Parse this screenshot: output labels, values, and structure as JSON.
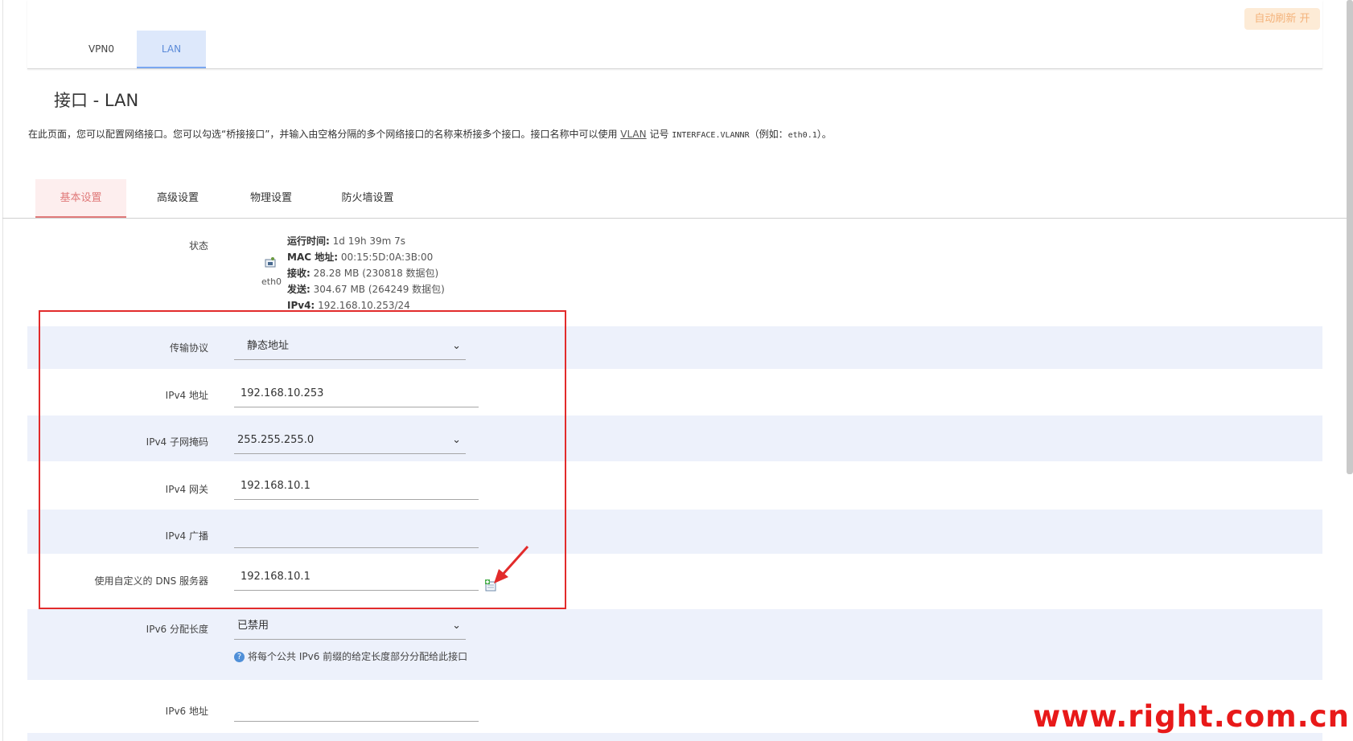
{
  "header": {
    "auto_refresh_label": "自动刷新 开",
    "tabs": [
      "VPN0",
      "LAN"
    ],
    "active_tab": "LAN"
  },
  "page": {
    "title": "接口 - LAN",
    "description_prefix": "在此页面，您可以配置网络接口。您可以勾选“桥接接口”，并输入由空格分隔的多个网络接口的名称来桥接多个接口。接口名称中可以使用 ",
    "description_link": "VLAN",
    "description_mid": " 记号 ",
    "description_code": "INTERFACE.VLANNR",
    "description_suffix": "（例如：",
    "description_example": "eth0.1",
    "description_end": "）。"
  },
  "sub_tabs": [
    "基本设置",
    "高级设置",
    "物理设置",
    "防火墙设置"
  ],
  "status": {
    "label": "状态",
    "device": "eth0",
    "uptime_label": "运行时间:",
    "uptime_value": "1d 19h 39m 7s",
    "mac_label": "MAC 地址:",
    "mac_value": "00:15:5D:0A:3B:00",
    "rx_label": "接收:",
    "rx_value": "28.28 MB (230818 数据包)",
    "tx_label": "发送:",
    "tx_value": "304.67 MB (264249 数据包)",
    "ipv4_label": "IPv4:",
    "ipv4_value": "192.168.10.253/24"
  },
  "form": {
    "protocol": {
      "label": "传输协议",
      "value": "静态地址"
    },
    "ipv4_addr": {
      "label": "IPv4 地址",
      "value": "192.168.10.253"
    },
    "ipv4_mask": {
      "label": "IPv4 子网掩码",
      "value": "255.255.255.0"
    },
    "ipv4_gw": {
      "label": "IPv4 网关",
      "value": "192.168.10.1"
    },
    "ipv4_bcast": {
      "label": "IPv4 广播",
      "value": ""
    },
    "dns": {
      "label": "使用自定义的 DNS 服务器",
      "value": "192.168.10.1"
    },
    "ipv6_len": {
      "label": "IPv6 分配长度",
      "value": "已禁用",
      "hint": "将每个公共 IPv6 前缀的给定长度部分分配给此接口"
    },
    "ipv6_addr": {
      "label": "IPv6 地址",
      "value": ""
    }
  },
  "watermark": "www.right.com.cn",
  "icons": {
    "chevron": "chevron-down-icon",
    "add": "add-dns-icon",
    "help": "help-icon",
    "ethernet": "ethernet-port-icon"
  },
  "colors": {
    "highlight_box": "#e22b2b",
    "active_top_tab": "#dde8fb",
    "active_sub_tab": "#e07a7a",
    "row_shade": "#edf1fb",
    "watermark": "#e81919"
  }
}
